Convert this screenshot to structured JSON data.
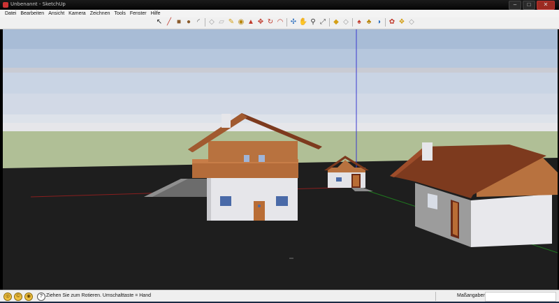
{
  "window": {
    "title": "Unbenannt - SketchUp",
    "min": "–",
    "max": "□",
    "close": "✕"
  },
  "menu": [
    "Datei",
    "Bearbeiten",
    "Ansicht",
    "Kamera",
    "Zeichnen",
    "Tools",
    "Fenster",
    "Hilfe"
  ],
  "toolbar": {
    "tools": [
      {
        "name": "select-tool-icon",
        "glyph": "↖",
        "color": "#222"
      },
      {
        "name": "line-tool-icon",
        "glyph": "╱",
        "color": "#c0392b"
      },
      {
        "name": "rectangle-tool-icon",
        "glyph": "■",
        "color": "#8a5a2b"
      },
      {
        "name": "circle-tool-icon",
        "glyph": "●",
        "color": "#8a5a2b"
      },
      {
        "name": "arc-tool-icon",
        "glyph": "◜",
        "color": "#555"
      },
      {
        "sep": true
      },
      {
        "name": "make-component-icon",
        "glyph": "◇",
        "color": "#999"
      },
      {
        "name": "eraser-tool-icon",
        "glyph": "▱",
        "color": "#aaa"
      },
      {
        "name": "tape-measure-icon",
        "glyph": "✎",
        "color": "#d4a017"
      },
      {
        "name": "paint-bucket-icon",
        "glyph": "◉",
        "color": "#b8860b"
      },
      {
        "name": "push-pull-icon",
        "glyph": "▲",
        "color": "#c0392b"
      },
      {
        "name": "move-tool-icon",
        "glyph": "✥",
        "color": "#c0392b"
      },
      {
        "name": "rotate-tool-icon",
        "glyph": "↻",
        "color": "#c0392b"
      },
      {
        "name": "offset-tool-icon",
        "glyph": "◠",
        "color": "#c0392b"
      },
      {
        "sep": true
      },
      {
        "name": "orbit-tool-icon",
        "glyph": "✣",
        "color": "#2c6fbf"
      },
      {
        "name": "pan-tool-icon",
        "glyph": "✋",
        "color": "#777"
      },
      {
        "name": "zoom-tool-icon",
        "glyph": "⚲",
        "color": "#333"
      },
      {
        "name": "zoom-extents-icon",
        "glyph": "⤢",
        "color": "#555"
      },
      {
        "sep": true
      },
      {
        "name": "get-models-icon",
        "glyph": "◆",
        "color": "#d4a017"
      },
      {
        "name": "share-model-icon",
        "glyph": "◇",
        "color": "#999"
      },
      {
        "sep": true
      },
      {
        "name": "sandbox-icon",
        "glyph": "♠",
        "color": "#c0392b"
      },
      {
        "name": "position-camera-icon",
        "glyph": "♣",
        "color": "#b8860b"
      },
      {
        "name": "add-location-icon",
        "glyph": "◑",
        "color": "#2c6fbf"
      },
      {
        "sep": true
      },
      {
        "name": "photo-textures-icon",
        "glyph": "✿",
        "color": "#c0392b"
      },
      {
        "name": "extension-warehouse-icon",
        "glyph": "❖",
        "color": "#d4a017"
      },
      {
        "name": "layout-icon",
        "glyph": "◇",
        "color": "#999"
      }
    ]
  },
  "statusbar": {
    "icons": [
      {
        "name": "geo-location-icon",
        "glyph": "◎"
      },
      {
        "name": "credits-icon",
        "glyph": "©"
      },
      {
        "name": "user-icon",
        "glyph": "◉"
      }
    ],
    "help_glyph": "?",
    "message": "Ziehen Sie zum Rotieren.  Umschalttaste = Hand",
    "measurements_label": "Maßangaben",
    "measurements_value": ""
  }
}
